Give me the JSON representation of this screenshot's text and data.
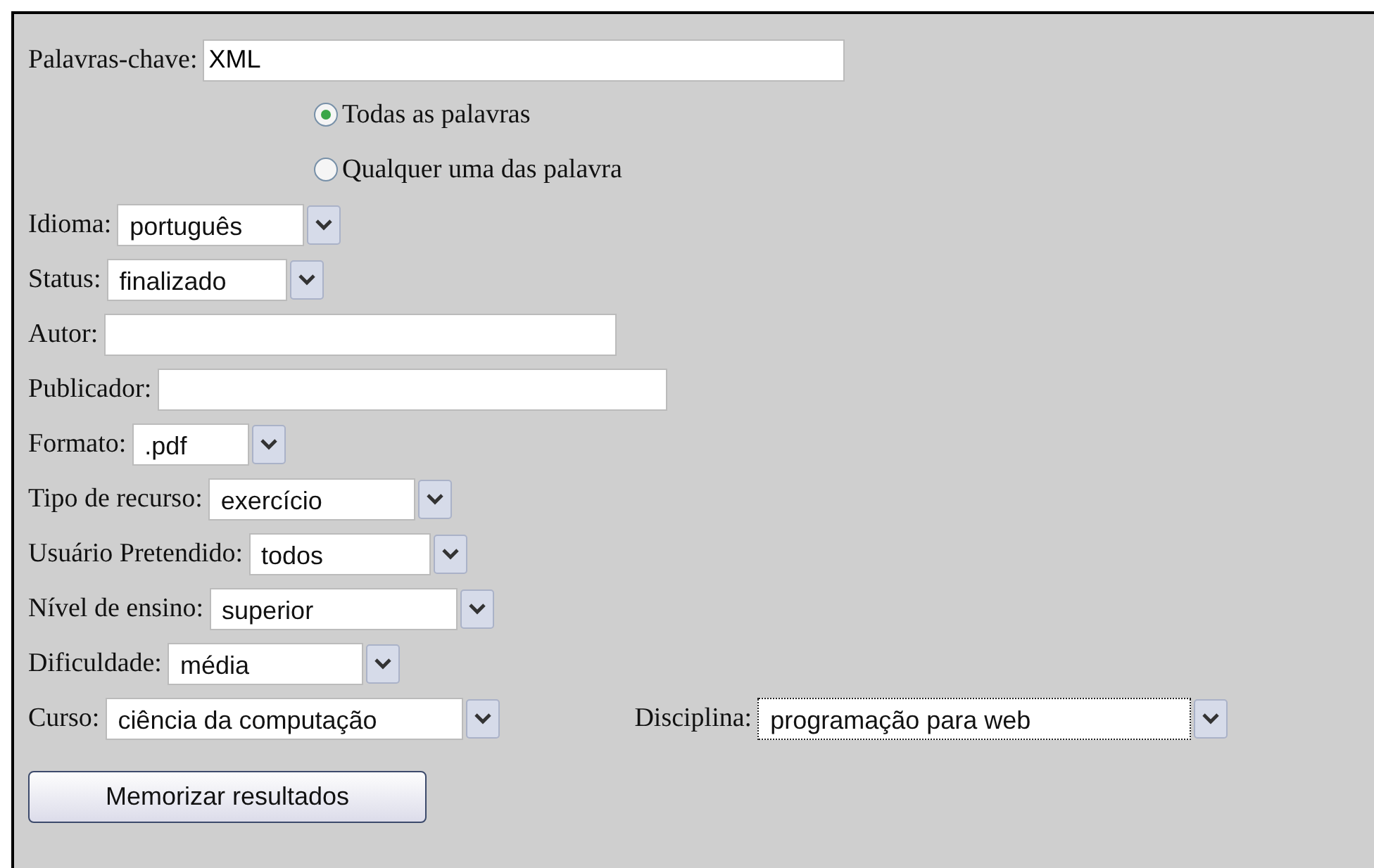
{
  "keywords": {
    "label": "Palavras-chave:",
    "value": "XML"
  },
  "match_options": [
    {
      "label": "Todas as palavras",
      "selected": true
    },
    {
      "label": "Qualquer uma das palavra",
      "selected": false
    }
  ],
  "fields": [
    {
      "kind": "select",
      "label": "Idioma:",
      "value": "português"
    },
    {
      "kind": "select",
      "label": "Status:",
      "value": "finalizado"
    },
    {
      "kind": "text",
      "label": "Autor:"
    },
    {
      "kind": "text",
      "label": "Publicador:"
    },
    {
      "kind": "select",
      "label": "Formato:",
      "value": ".pdf"
    },
    {
      "kind": "select",
      "label": "Tipo de recurso:",
      "value": "exercício"
    },
    {
      "kind": "select",
      "label": "Usuário Pretendido:",
      "value": "todos"
    },
    {
      "kind": "select",
      "label": "Nível de ensino:",
      "value": "superior"
    },
    {
      "kind": "select",
      "label": "Dificuldade:",
      "value": "média"
    }
  ],
  "course": {
    "label": "Curso:",
    "value": "ciência da computação",
    "focused": false
  },
  "subject": {
    "label": "Disciplina:",
    "value": "programação para web",
    "focused": true
  },
  "button": "Memorizar resultados"
}
